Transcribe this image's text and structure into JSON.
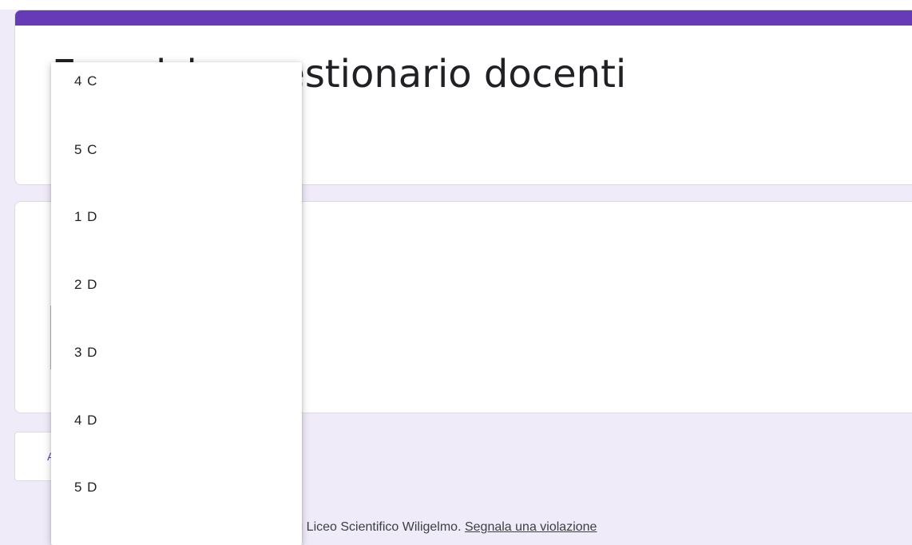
{
  "form": {
    "title": "Esercizio questionario docenti",
    "accent_color": "#673ab7",
    "background_color": "#f0ebf8"
  },
  "nav": {
    "next_button_label": "Avanti"
  },
  "footer": {
    "text": "Questo modulo è stato creato all'interno di Liceo Scientifico Wiligelmo.",
    "report_link": "Segnala una violazione"
  },
  "dropdown": {
    "options": [
      "4 C",
      "5 C",
      "1 D",
      "2 D",
      "3 D",
      "4 D",
      "5 D"
    ]
  }
}
